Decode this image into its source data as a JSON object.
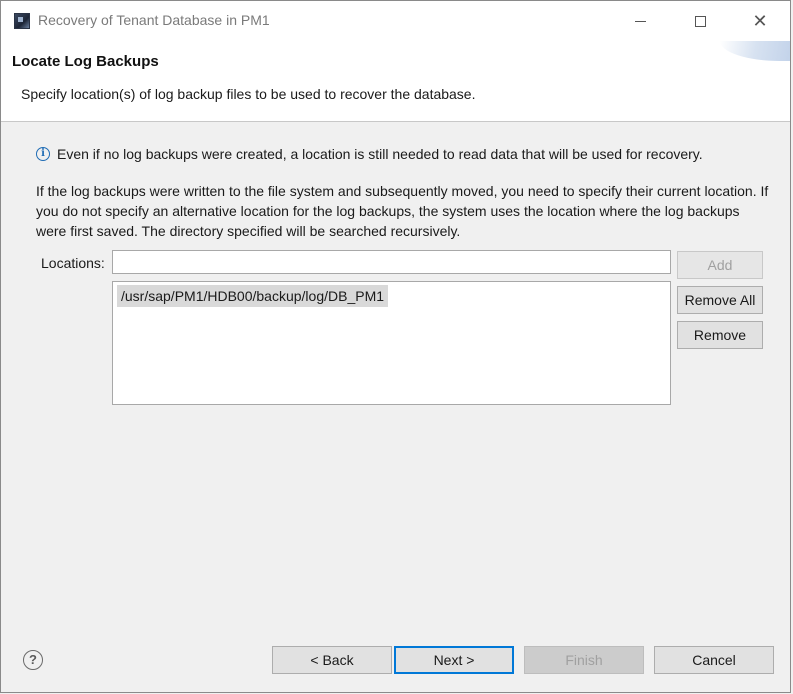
{
  "window": {
    "title": "Recovery of Tenant Database in PM1",
    "icons": {
      "app": "sap-hana-studio-icon",
      "minimize": "minimize-icon",
      "maximize": "maximize-icon",
      "close": "close-icon"
    }
  },
  "header": {
    "title": "Locate Log Backups",
    "description": "Specify location(s) of log backup files to be used to recover the database."
  },
  "info": {
    "icon": "info-icon",
    "text": "Even if no log backups were created, a location is still needed to read data that will be used for recovery."
  },
  "paragraph": "If the log backups were written to the file system and subsequently moved, you need to specify their current location. If you do not specify an alternative location for the log backups, the system uses the location where the log backups were first saved. The directory specified will be searched recursively.",
  "locations": {
    "label": "Locations:",
    "input_value": "",
    "items": [
      "/usr/sap/PM1/HDB00/backup/log/DB_PM1"
    ]
  },
  "side_buttons": {
    "add": "Add",
    "remove_all": "Remove All",
    "remove": "Remove"
  },
  "footer": {
    "help_icon": "help-icon",
    "back": "< Back",
    "next": "Next >",
    "finish": "Finish",
    "cancel": "Cancel"
  },
  "colors": {
    "accent": "#0078d7",
    "info_icon": "#1f6cb5",
    "selection": "#d9d9d9"
  }
}
